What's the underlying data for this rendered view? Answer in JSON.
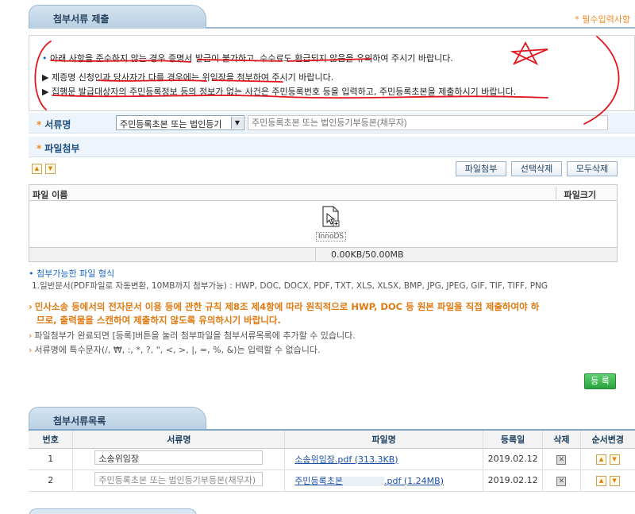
{
  "section1": {
    "title": "첨부서류 제출",
    "required_note": "* 필수입력사항"
  },
  "notice": {
    "line1": "아래 사항을 준수하지 않는 경우 증명서 발급이 불가하고, 수수료도 환급되지 않음을 유의하여 주시기 바랍니다.",
    "line2": "▶ 제증명 신청인과 당사자가 다를 경우에는 위임장을 첨부하여 주시기 바랍니다.",
    "line3": "▶ 집행문 발급대상자의 주민등록정보 등의 정보가 없는 사건은 주민등록번호 등을 입력하고, 주민등록초본을 제출하시기 바랍니다."
  },
  "doc_name": {
    "label": "서류명",
    "selected": "주민등록초본 또는 법인등기",
    "input_placeholder": "주민등록초본 또는 법인등기부등본(채무자)"
  },
  "attach": {
    "label": "파일첨부",
    "buttons": {
      "attach": "파일첨부",
      "delete_selected": "선택삭제",
      "delete_all": "모두삭제"
    },
    "table": {
      "col_name": "파일 이름",
      "col_size": "파일크기"
    },
    "drop_label": "InnoDS",
    "size_status": "0.00KB/50.00MB"
  },
  "formats": {
    "title": "첨부가능한 파일 형식",
    "detail": "1.일반문서(PDF파일로 자동변환, 10MB까지 첨부가능) : HWP, DOC, DOCX, PDF, TXT, XLS, XLSX, BMP, JPG, JPEG, GIF, TIF, TIFF, PNG"
  },
  "guides": {
    "warn_line1": "민사소송 등에서의 전자문서 이용 등에 관한 규칙 제8조 제4항에 따라 원칙적으로 HWP, DOC 등 원본 파일을 직접 제출하여야 하",
    "warn_line2": "므로, 출력물을 스캔하여 제출하지 않도록 유의하시기 바랍니다.",
    "g2": "파일첨부가 완료되면 [등록]버튼을 눌러 첨부파일을 첨부서류목록에 추가할 수 있습니다.",
    "g3": "서류명에 특수문자(/, ₩, :, *, ?, \", <, >, |, =, %, &)는 입력할 수 없습니다."
  },
  "register_button": "등 록",
  "section2": {
    "title": "첨부서류목록"
  },
  "list": {
    "headers": [
      "번호",
      "서류명",
      "파일명",
      "등록일",
      "삭제",
      "순서변경"
    ],
    "rows": [
      {
        "no": "1",
        "doc": "소송위임장",
        "file": "소송위임장.pdf (313.3KB)",
        "date": "2019.02.12"
      },
      {
        "no": "2",
        "doc": "주민등록초본 또는 법인등기부등본(채무자)",
        "file_a": "주민등록초본",
        "file_b": ".pdf (1.24MB)",
        "date": "2019.02.12"
      }
    ]
  },
  "colors": {
    "accent_orange": "#e07a12",
    "header_blue": "#1d4f7e",
    "annotation_red": "#e2141d"
  }
}
